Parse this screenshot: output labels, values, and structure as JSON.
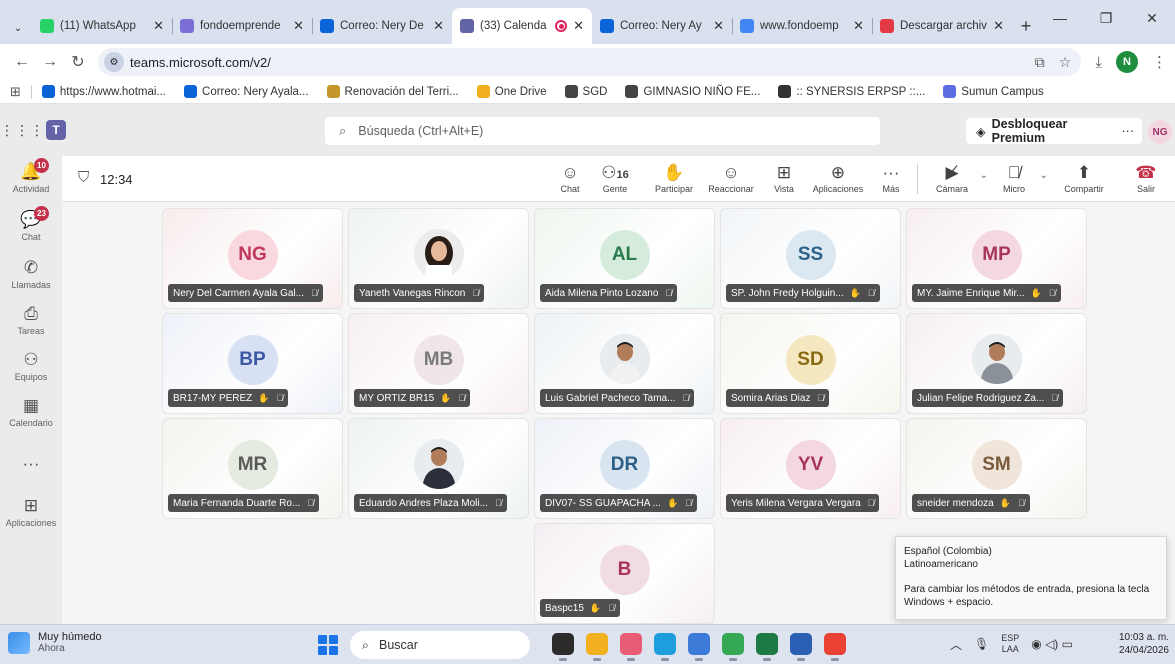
{
  "browser": {
    "tabs": [
      {
        "title": "(11) WhatsApp",
        "icon": "whatsapp-icon",
        "color": "#25d366",
        "badge": "11"
      },
      {
        "title": "fondoemprende",
        "icon": "form-icon",
        "color": "#7b6fd6"
      },
      {
        "title": "Correo: Nery De",
        "icon": "outlook-icon",
        "color": "#0a64d8"
      },
      {
        "title": "(33) Calenda",
        "icon": "teams-icon",
        "color": "#6264a7",
        "active": true
      },
      {
        "title": "Correo: Nery Ay",
        "icon": "outlook-icon",
        "color": "#0a64d8"
      },
      {
        "title": "www.fondoemp",
        "icon": "google-icon",
        "color": "#4285f4"
      },
      {
        "title": "Descargar archiv",
        "icon": "heart-icon",
        "color": "#e63946"
      }
    ],
    "url": "teams.microsoft.com/v2/",
    "profile_initial": "N",
    "bookmarks": [
      {
        "label": "https://www.hotmai...",
        "color": "#0a64d8"
      },
      {
        "label": "Correo: Nery Ayala...",
        "color": "#0a64d8"
      },
      {
        "label": "Renovación del Terri...",
        "color": "#c5962c"
      },
      {
        "label": "One Drive",
        "color": "#f2b01e"
      },
      {
        "label": "SGD",
        "color": "#444444"
      },
      {
        "label": "GIMNASIO NIÑO FE...",
        "color": "#444444"
      },
      {
        "label": ":: SYNERSIS ERPSP ::...",
        "color": "#333333"
      },
      {
        "label": "Sumun Campus",
        "color": "#5b6ee1"
      }
    ]
  },
  "teams": {
    "search_placeholder": "Búsqueda (Ctrl+Alt+E)",
    "premium_label": "Desbloquear Premium",
    "premium_more": "···",
    "user_initials": "NG",
    "rail": [
      {
        "label": "Actividad",
        "icon": "bell-icon",
        "glyph": "🔔",
        "badge": "10"
      },
      {
        "label": "Chat",
        "icon": "chat-icon",
        "glyph": "💬",
        "badge": "23"
      },
      {
        "label": "Llamadas",
        "icon": "phone-icon",
        "glyph": "✆"
      },
      {
        "label": "Tareas",
        "icon": "tasks-icon",
        "glyph": "⎙"
      },
      {
        "label": "Equipos",
        "icon": "teams-group-icon",
        "glyph": "⚇"
      },
      {
        "label": "Calendario",
        "icon": "calendar-icon",
        "glyph": "▦"
      },
      {
        "label": "",
        "icon": "more-icon",
        "glyph": "···"
      },
      {
        "label": "Aplicaciones",
        "icon": "apps-add-icon",
        "glyph": "⊞"
      }
    ],
    "meeting": {
      "timer": "12:34",
      "people_count": "16",
      "controls": {
        "chat": "Chat",
        "people": "Gente",
        "raise": "Participar",
        "react": "Reaccionar",
        "view": "Vista",
        "apps": "Aplicaciones",
        "more": "Más",
        "camera": "Cámara",
        "mic": "Micro",
        "share": "Compartir",
        "leave": "Salir"
      }
    },
    "participants": [
      {
        "name": "Nery Del Carmen Ayala Gal...",
        "initials": "NG",
        "bg": "#f7ecec",
        "fg": "#c0395a",
        "avbg": "#f9d8df",
        "hand": false
      },
      {
        "name": "Yaneth Vanegas Rincon",
        "initials": "",
        "photo": "woman",
        "bg": "#eef3f0",
        "hand": false
      },
      {
        "name": "Aida Milena Pinto Lozano",
        "initials": "AL",
        "bg": "#eef6ef",
        "fg": "#2b7a4b",
        "avbg": "#d5ecdc",
        "hand": false
      },
      {
        "name": "SP. John Fredy Holguin...",
        "initials": "SS",
        "bg": "#f2f5f8",
        "fg": "#2b5f86",
        "avbg": "#dce8f1",
        "hand": true
      },
      {
        "name": "MY. Jaime Enrique Mir...",
        "initials": "MP",
        "bg": "#f7eef1",
        "fg": "#a7345a",
        "avbg": "#f3d8e0",
        "hand": true
      },
      {
        "name": "BR17-MY PEREZ",
        "initials": "BP",
        "bg": "#eef1f8",
        "fg": "#3b58a3",
        "avbg": "#d8e0f3",
        "hand": true
      },
      {
        "name": "MY ORTIZ BR15",
        "initials": "MB",
        "bg": "#f6eef3",
        "fg": "#7a7a7a",
        "avbg": "#efe5ea",
        "hand": true
      },
      {
        "name": "Luis Gabriel Pacheco Tama...",
        "initials": "",
        "photo": "man",
        "bg": "#eef2f5",
        "hand": false
      },
      {
        "name": "Somira Arias Diaz",
        "initials": "SD",
        "bg": "#f4f6ee",
        "fg": "#8a6a12",
        "avbg": "#f5e7c0",
        "hand": false
      },
      {
        "name": "Julian Felipe Rodriguez Za...",
        "initials": "",
        "photo": "man2",
        "bg": "#f4eef3",
        "hand": false
      },
      {
        "name": "Maria Fernanda Duarte Ro...",
        "initials": "MR",
        "bg": "#f1f4ee",
        "fg": "#5a5a5a",
        "avbg": "#e6ebe1",
        "hand": false
      },
      {
        "name": "Eduardo Andres Plaza Moli...",
        "initials": "",
        "photo": "man3",
        "bg": "#eef2f3",
        "hand": false
      },
      {
        "name": "DIV07- SS GUAPACHA ...",
        "initials": "DR",
        "bg": "#eef1f7",
        "fg": "#2b5f86",
        "avbg": "#d8e4f0",
        "hand": true
      },
      {
        "name": "Yeris Milena Vergara Vergara",
        "initials": "YV",
        "bg": "#f7eef2",
        "fg": "#a7345a",
        "avbg": "#f3d8e3",
        "hand": false
      },
      {
        "name": "sneider mendoza",
        "initials": "SM",
        "bg": "#f5f3ee",
        "fg": "#7a5a3a",
        "avbg": "#efe5da",
        "hand": true
      },
      {
        "name": "Baspc15",
        "initials": "B",
        "bg": "#f4eef3",
        "fg": "#a7345a",
        "avbg": "#f1dce6",
        "hand": true
      }
    ],
    "lang_popup": {
      "line1": "Español (Colombia)",
      "line2": "Latinoamericano",
      "line3": "Para cambiar los métodos de entrada, presiona la tecla Windows + espacio."
    }
  },
  "taskbar": {
    "weather_line1": "Muy húmedo",
    "weather_line2": "Ahora",
    "search_label": "Buscar",
    "lang_top": "ESP",
    "lang_bottom": "LAA",
    "time": "10:03 a. m.",
    "date": "24/04/2026"
  }
}
